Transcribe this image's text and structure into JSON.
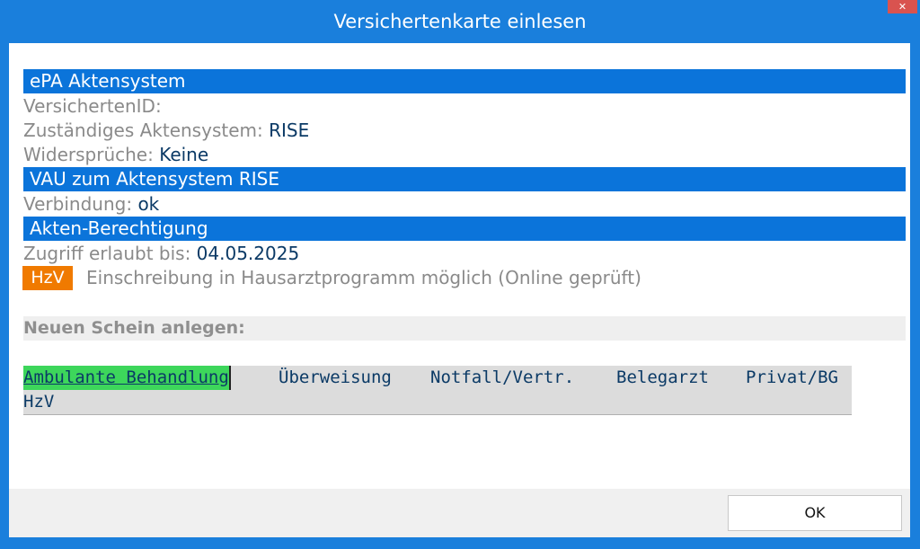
{
  "window": {
    "title": "Versichertenkarte einlesen",
    "close_label": "✕"
  },
  "epa": {
    "header": "ePA Aktensystem",
    "versicherten_id_label": "VersichertenID:",
    "versicherten_id_value": "",
    "aktensystem_label": "Zuständiges Aktensystem:",
    "aktensystem_value": "RISE",
    "widersprueche_label": "Widersprüche:",
    "widersprueche_value": "Keine"
  },
  "vau": {
    "header": "VAU zum Aktensystem RISE",
    "verbindung_label": "Verbindung:",
    "verbindung_value": "ok"
  },
  "berechtigung": {
    "header": "Akten-Berechtigung",
    "zugriff_label": "Zugriff erlaubt bis:",
    "zugriff_value": "04.05.2025"
  },
  "hzv": {
    "badge": "HzV",
    "text": "Einschreibung in Hausarztprogramm möglich (Online geprüft)"
  },
  "neuer_schein": {
    "header": "Neuen Schein anlegen:",
    "options": [
      "Ambulante Behandlung",
      "Überweisung",
      "Notfall/Vertr.",
      "Belegarzt",
      "Privat/BG",
      "HzV"
    ],
    "selected": "Ambulante Behandlung"
  },
  "footer": {
    "ok_label": "OK"
  },
  "colors": {
    "titlebar": "#1a7fdc",
    "section_bar": "#0b74da",
    "hzv_badge": "#f07a00",
    "selected_option": "#3dd65b",
    "value_text": "#0b3a66",
    "label_text": "#8a8a8a"
  }
}
